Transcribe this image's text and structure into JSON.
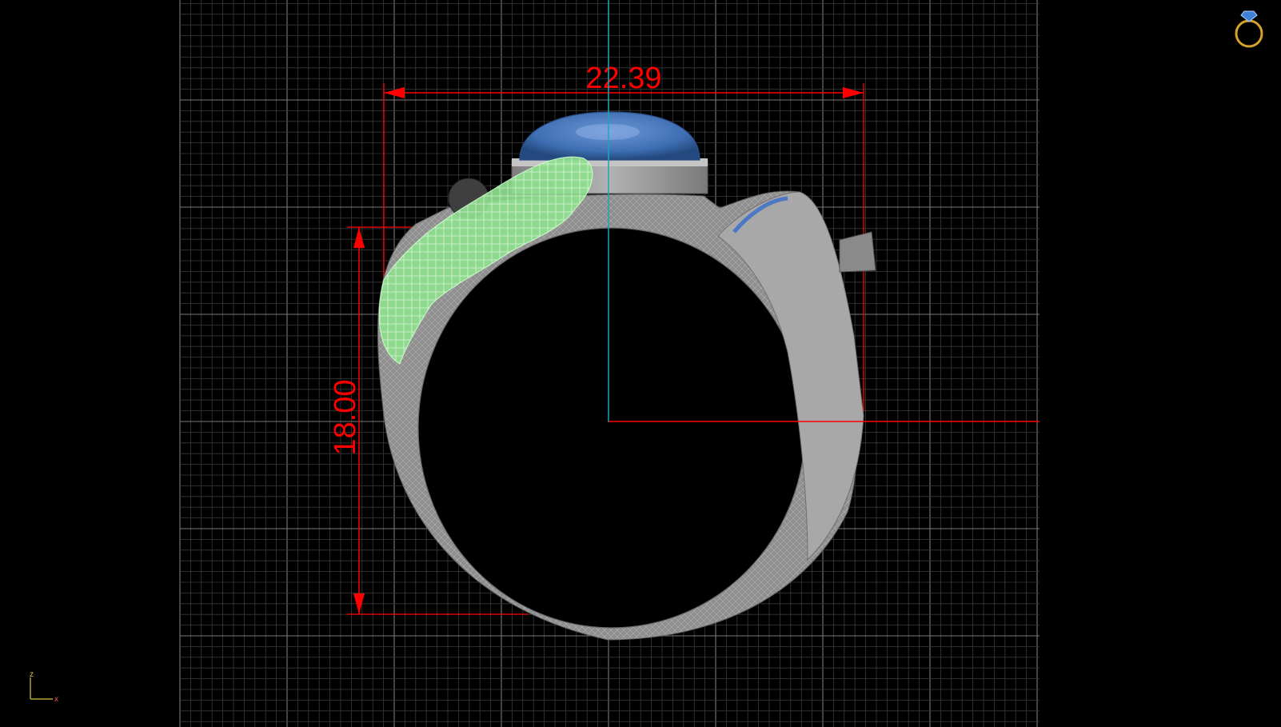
{
  "viewport": {
    "view": "Front",
    "colors": {
      "background": "#000000",
      "grid_minor": "#3a3a3a",
      "grid_major": "#7a7a7a",
      "dimension": "#ff0000",
      "axis_vertical": "#1aa6b7",
      "metal": "#9a9a9a",
      "gem": "#3e6fb3",
      "selection_wire": "#9cf59c"
    }
  },
  "dimensions": {
    "width_label": "22.39",
    "height_label": "18.00"
  },
  "axis_indicator": {
    "z_label": "z",
    "x_label": "x"
  },
  "corner_icon": {
    "icon": "ring-icon"
  }
}
